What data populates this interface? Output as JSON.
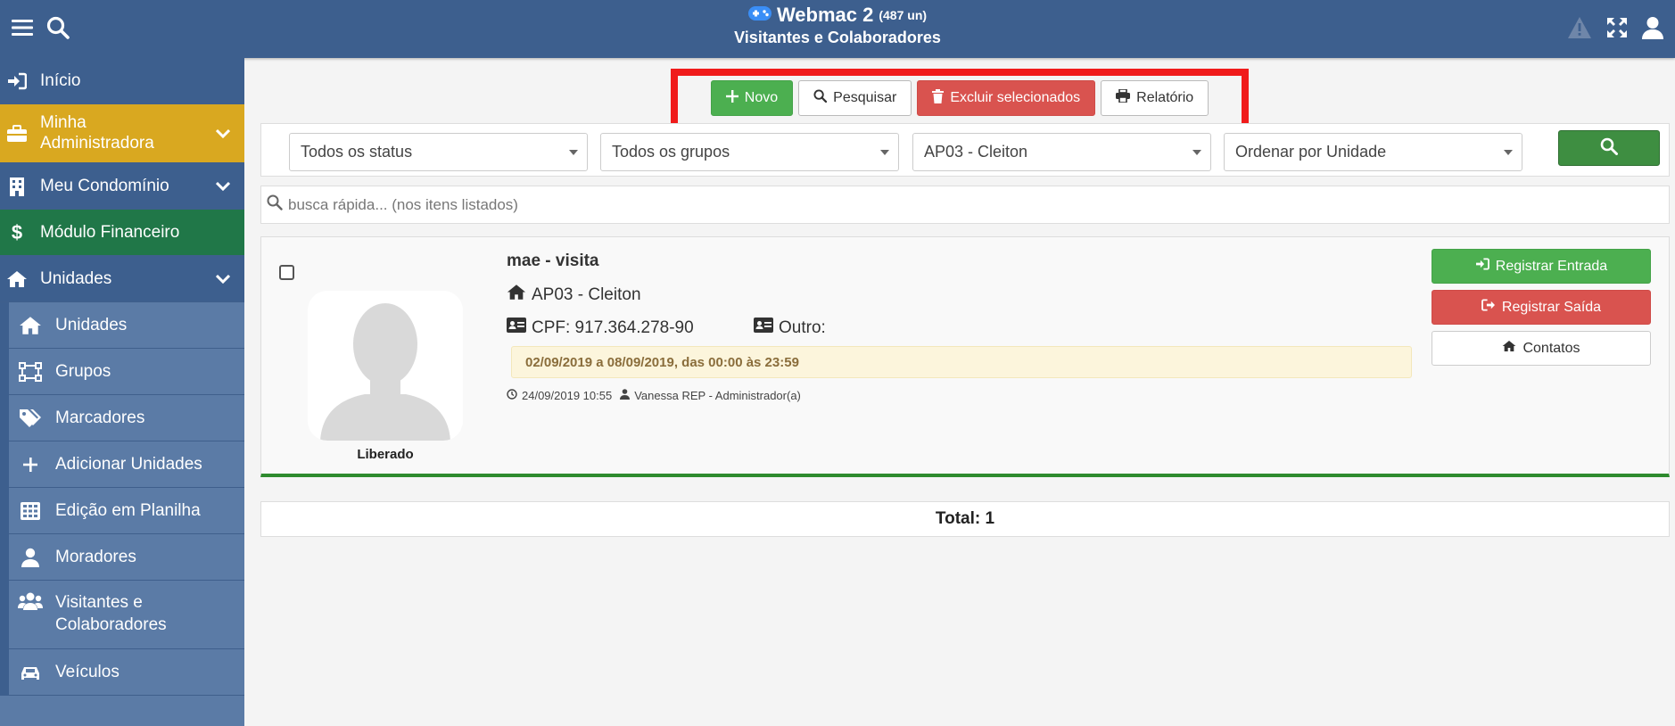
{
  "header": {
    "app_title": "Webmac 2",
    "count": "(487 un)",
    "subtitle": "Visitantes e Colaboradores",
    "icons": [
      "menu-icon",
      "search-icon",
      "warning-icon",
      "expand-icon",
      "user-icon"
    ]
  },
  "sidebar": {
    "items": [
      {
        "label": "Início",
        "icon": "sign-in-icon"
      },
      {
        "label": "Minha Administradora",
        "icon": "briefcase-icon"
      },
      {
        "label": "Meu Condomínio",
        "icon": "building-icon"
      },
      {
        "label": "Módulo Financeiro",
        "icon": "dollar-icon"
      },
      {
        "label": "Unidades",
        "icon": "home-icon"
      }
    ],
    "subitems": [
      {
        "label": "Unidades",
        "icon": "home-icon"
      },
      {
        "label": "Grupos",
        "icon": "groups-icon"
      },
      {
        "label": "Marcadores",
        "icon": "tags-icon"
      },
      {
        "label": "Adicionar Unidades",
        "icon": "plus-icon"
      },
      {
        "label": "Edição em Planilha",
        "icon": "table-icon"
      },
      {
        "label": "Moradores",
        "icon": "user-icon"
      },
      {
        "label": "Visitantes e Colaboradores",
        "icon": "users-icon"
      },
      {
        "label": "Veículos",
        "icon": "car-icon"
      }
    ]
  },
  "toolbar": {
    "novo": "Novo",
    "pesquisar": "Pesquisar",
    "excluir": "Excluir selecionados",
    "relatorio": "Relatório"
  },
  "filters": {
    "status": "Todos os status",
    "grupos": "Todos os grupos",
    "unidade": "AP03 - Cleiton",
    "ordenar": "Ordenar por Unidade"
  },
  "quick_search": {
    "placeholder": "busca rápida... (nos itens listados)"
  },
  "record": {
    "name": "mae - visita",
    "unit": "AP03 - Cleiton",
    "cpf": "CPF: 917.364.278-90",
    "outro": "Outro:",
    "period": "02/09/2019 a 08/09/2019, das 00:00 às 23:59",
    "timestamp": "24/09/2019 10:55",
    "author": "Vanessa REP - Administrador(a)",
    "status": "Liberado",
    "actions": {
      "entrada": "Registrar Entrada",
      "saida": "Registrar Saída",
      "contatos": "Contatos"
    }
  },
  "total": "Total: 1",
  "colors": {
    "header_blue": "#3d5f8e",
    "sidebar_blue": "#5b7ba6",
    "yellow": "#d9a820",
    "dark_green": "#207748",
    "button_green": "#4caf50",
    "button_red": "#d9534f",
    "highlight_red": "#f01b1b"
  }
}
